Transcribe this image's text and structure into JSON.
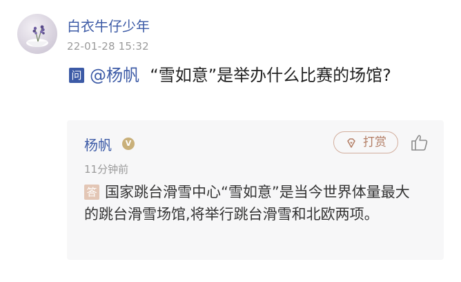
{
  "post": {
    "username": "白衣牛仔少年",
    "timestamp": "22-01-28 15:32",
    "question_badge": "问",
    "mention": "@杨帆",
    "question_text": "“雪如意”是举办什么比赛的场馆?"
  },
  "answer": {
    "author": "杨帆",
    "verified_icon": "v-badge-icon",
    "reward_label": "打赏",
    "reward_icon": "diamond-icon",
    "like_icon": "thumbs-up-icon",
    "time": "11分钟前",
    "answer_badge": "答",
    "text": "国家跳台滑雪中心“雪如意”是当今世界体量最大的跳台滑雪场馆,将举行跳台滑雪和北欧两项。"
  },
  "colors": {
    "brand_blue": "#3c5aa6",
    "muted_gray": "#9a9a9a",
    "reward_tan": "#b27c63",
    "card_bg": "#f7f7f8"
  }
}
